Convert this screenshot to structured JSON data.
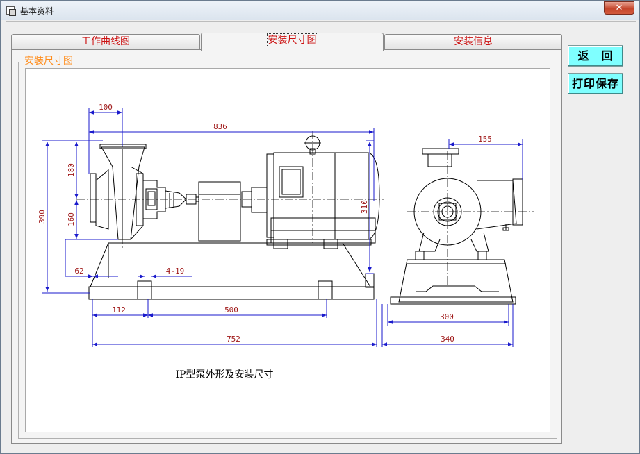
{
  "window": {
    "title": "基本资料",
    "close_label": "✕"
  },
  "tabs": [
    {
      "label": "工作曲线图",
      "active": false
    },
    {
      "label": "安装尺寸图",
      "active": true
    },
    {
      "label": "安装信息",
      "active": false
    }
  ],
  "group": {
    "label": "安装尺寸图"
  },
  "drawing": {
    "caption": "IP型泵外形及安装尺寸",
    "dims": {
      "d100": "100",
      "d836": "836",
      "d155": "155",
      "d180": "180",
      "d390": "390",
      "d160": "160",
      "d310": "310",
      "d62": "62",
      "d4_19": "4-19",
      "d112": "112",
      "d500": "500",
      "d752": "752",
      "d300": "300",
      "d340": "340"
    }
  },
  "buttons": {
    "back": "返　回",
    "print_save": "打印保存"
  },
  "colors": {
    "dimension": "#1a1acc",
    "dimension_text": "#a01a1a",
    "tab_text": "#cc1111",
    "group_label": "#ff8c1a",
    "button_bg": "#7fffff"
  }
}
